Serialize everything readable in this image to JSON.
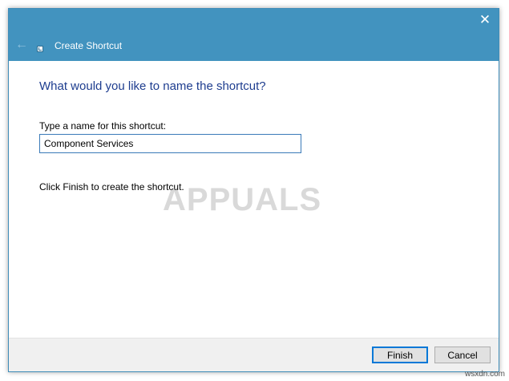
{
  "window": {
    "title": "Create Shortcut",
    "close_glyph": "✕",
    "back_glyph": "←"
  },
  "wizard": {
    "heading": "What would you like to name the shortcut?",
    "field_label": "Type a name for this shortcut:",
    "name_value": "Component Services",
    "finish_hint": "Click Finish to create the shortcut."
  },
  "buttons": {
    "finish_label": "Finish",
    "cancel_label": "Cancel"
  },
  "watermarks": {
    "logo_text": "APPUALS",
    "site": "wsxdn.com"
  },
  "icons": {
    "close": "close-icon",
    "back": "back-arrow-icon",
    "shortcut": "shortcut-icon"
  },
  "colors": {
    "titlebar": "#4293bf",
    "heading": "#1e3d8f",
    "input_border": "#3a7ab8",
    "primary_button_border": "#0078d7"
  }
}
